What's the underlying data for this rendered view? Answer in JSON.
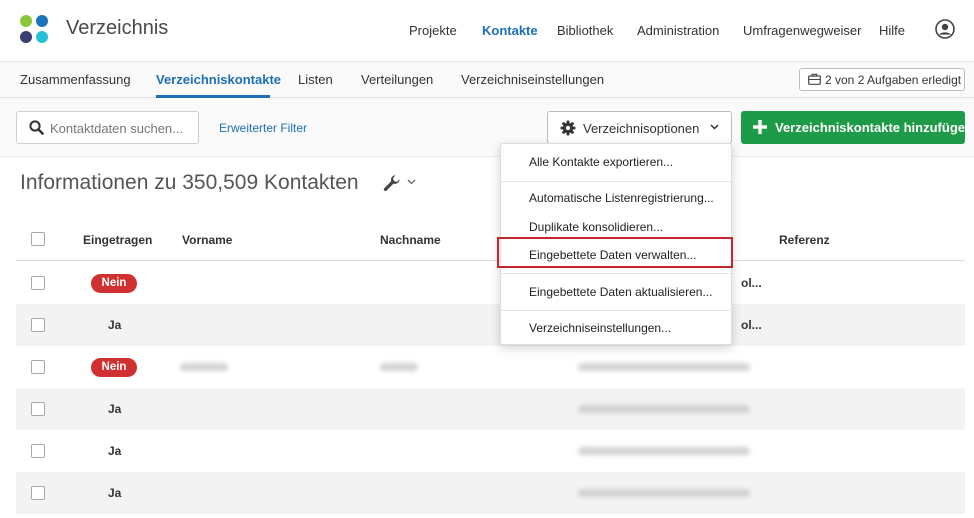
{
  "app": {
    "title": "Verzeichnis"
  },
  "topnav": [
    {
      "label": "Projekte",
      "active": false
    },
    {
      "label": "Kontakte",
      "active": true
    },
    {
      "label": "Bibliothek",
      "active": false
    },
    {
      "label": "Administration",
      "active": false
    },
    {
      "label": "Umfragenwegweiser",
      "active": false
    },
    {
      "label": "Hilfe",
      "active": false
    }
  ],
  "subnav": {
    "tabs": [
      {
        "label": "Zusammenfassung",
        "active": false
      },
      {
        "label": "Verzeichniskontakte",
        "active": true
      },
      {
        "label": "Listen",
        "active": false
      },
      {
        "label": "Verteilungen",
        "active": false
      },
      {
        "label": "Verzeichniseinstellungen",
        "active": false
      }
    ],
    "tasks_label": "2 von 2 Aufgaben erledigt"
  },
  "toolbar": {
    "search_placeholder": "Kontaktdaten suchen...",
    "advanced_filter": "Erweiterter Filter",
    "options_label": "Verzeichnisoptionen",
    "add_label": "Verzeichniskontakte hinzufügen"
  },
  "heading": "Informationen zu 350,509 Kontakten",
  "table": {
    "headers": {
      "registered": "Eingetragen",
      "firstname": "Vorname",
      "lastname": "Nachname",
      "reference": "Referenz"
    },
    "rows": [
      {
        "registered": "Nein",
        "email_fragment": "ol..."
      },
      {
        "registered": "Ja",
        "email_fragment": "ol..."
      },
      {
        "registered": "Nein",
        "email_fragment": ""
      },
      {
        "registered": "Ja",
        "email_fragment": ""
      },
      {
        "registered": "Ja",
        "email_fragment": ""
      },
      {
        "registered": "Ja",
        "email_fragment": ""
      }
    ]
  },
  "menu": {
    "items": [
      {
        "label": "Alle Kontakte exportieren..."
      },
      {
        "label": "Automatische Listenregistrierung..."
      },
      {
        "label": "Duplikate konsolidieren..."
      },
      {
        "label": "Eingebettete Daten verwalten...",
        "highlighted": true
      },
      {
        "label": "Eingebettete Daten aktualisieren..."
      },
      {
        "label": "Verzeichniseinstellungen..."
      }
    ]
  },
  "colors": {
    "accent": "#1d70b8",
    "add_button": "#1e9b48",
    "nein_badge": "#d0302f",
    "highlight": "#c6262e"
  }
}
